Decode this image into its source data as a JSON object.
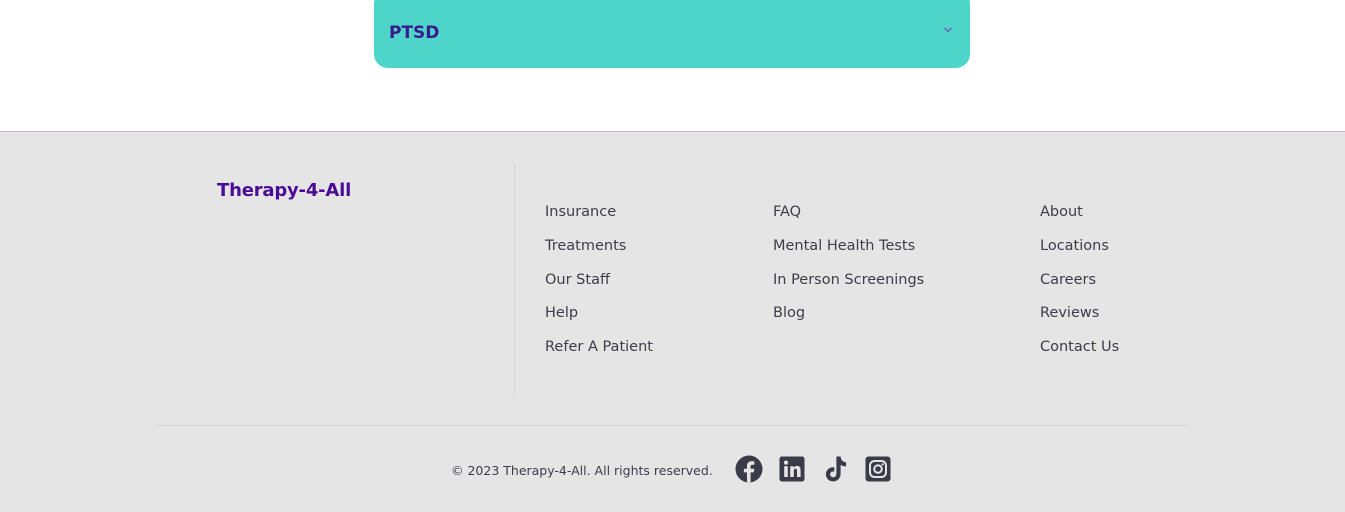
{
  "accordion": {
    "label": "PTSD",
    "chevron_icon": "chevron-down-icon"
  },
  "footer": {
    "brand": "Therapy-4-All",
    "columns": [
      [
        "Insurance",
        "Treatments",
        "Our Staff",
        "Help",
        "Refer A Patient"
      ],
      [
        "FAQ",
        "Mental Health Tests",
        "In Person Screenings",
        "Blog"
      ],
      [
        "About",
        "Locations",
        "Careers",
        "Reviews",
        "Contact Us"
      ]
    ],
    "copyright": "© 2023 Therapy-4-All. All rights reserved.",
    "social_icons": [
      "facebook-icon",
      "linkedin-icon",
      "tiktok-icon",
      "instagram-icon"
    ]
  },
  "colors": {
    "accordion_bg": "#4dd5ca",
    "accordion_text": "#3a1a8c",
    "brand": "#4a0c96",
    "footer_bg": "#e5e5e6",
    "footer_border": "#c5b4e3",
    "link_text": "#3d3d4a",
    "icon": "#3a3a48"
  }
}
